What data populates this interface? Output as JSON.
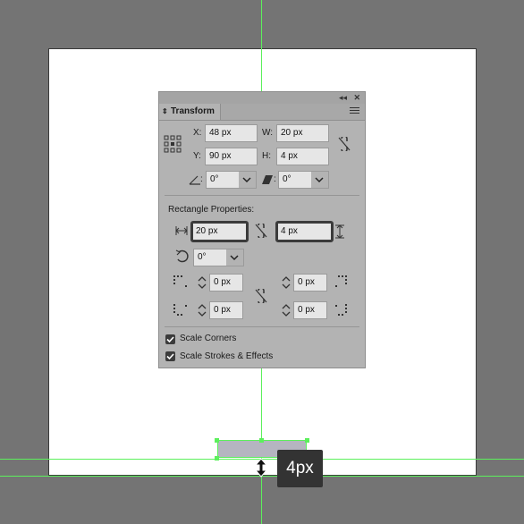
{
  "panel": {
    "title": "Transform",
    "x_label": "X:",
    "x_value": "48 px",
    "y_label": "Y:",
    "y_value": "90 px",
    "w_label": "W:",
    "w_value": "20 px",
    "h_label": "H:",
    "h_value": "4 px",
    "angle_label": ":",
    "angle_value": "0°",
    "shear_label": ":",
    "shear_value": "0°",
    "rect_props_title": "Rectangle Properties:",
    "rect_width_value": "20 px",
    "rect_height_value": "4 px",
    "rotate_value": "0°",
    "corner_tl": "0 px",
    "corner_tr": "0 px",
    "corner_bl": "0 px",
    "corner_br": "0 px",
    "scale_corners_label": "Scale Corners",
    "scale_corners_checked": true,
    "scale_strokes_label": "Scale Strokes & Effects",
    "scale_strokes_checked": true
  },
  "canvas": {
    "tooltip_text": "4px",
    "guide_color": "#5cf05c",
    "rect_fill": "#b5b5c0"
  }
}
